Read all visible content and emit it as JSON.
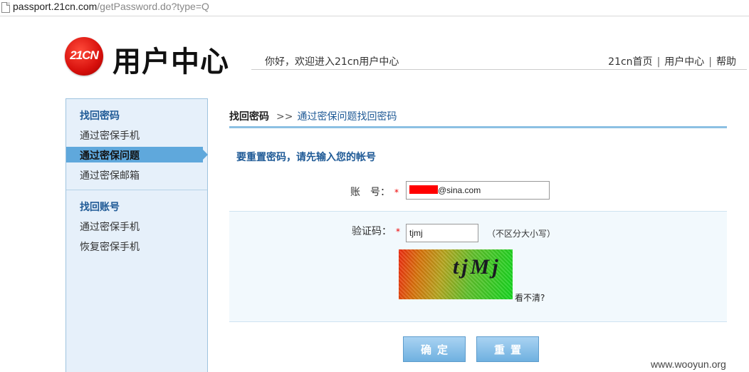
{
  "browser": {
    "url_host": "passport.21cn.com",
    "url_path": "/getPassword.do?type=Q"
  },
  "header": {
    "logo_text": "21CN",
    "title": "用户中心",
    "welcome": "你好，欢迎进入21cn用户中心",
    "links": [
      "21cn首页",
      "用户中心",
      "帮助"
    ],
    "link_separator": "|"
  },
  "sidebar": {
    "group1_title": "找回密码",
    "group1_items": [
      "通过密保手机",
      "通过密保问题",
      "通过密保邮箱"
    ],
    "active_index": 1,
    "group2_title": "找回账号",
    "group2_items": [
      "通过密保手机",
      "恢复密保手机"
    ]
  },
  "main": {
    "breadcrumb_current": "找回密码",
    "breadcrumb_sep": ">>",
    "breadcrumb_sub": "通过密保问题找回密码",
    "section_title": "要重置密码，请先输入您的帐号",
    "account_label": "账　号：",
    "account_value": "@sina.com",
    "captcha_label": "验证码：",
    "required_mark": "*",
    "captcha_value": "tjmj",
    "captcha_hint": "（不区分大小写）",
    "captcha_image_text": "tjMj",
    "cant_see": "看不清?",
    "confirm_button": "确定",
    "reset_button": "重置"
  },
  "watermark": "www.wooyun.org",
  "colors": {
    "accent": "#1f5a96",
    "sidebar_bg": "#e6f0fa",
    "active_item": "#5fa8dc",
    "logo_red": "#d7100c"
  }
}
